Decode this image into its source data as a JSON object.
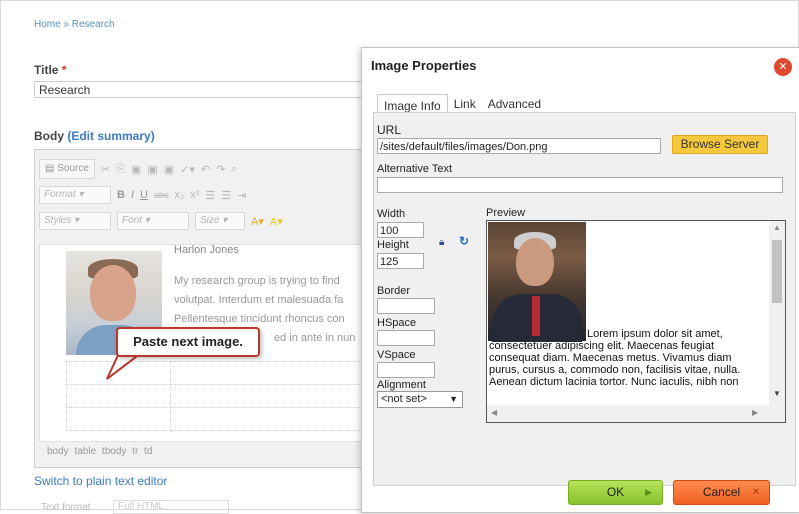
{
  "breadcrumb": {
    "text": "Home » Research"
  },
  "title_field": {
    "label": "Title",
    "required_mark": "*",
    "value": "Research"
  },
  "body_field": {
    "label": "Body",
    "edit_summary": "(Edit summary)"
  },
  "editor": {
    "source_label": "Source",
    "format_label": "Format",
    "styles_label": "Styles",
    "font_label": "Font",
    "size_label": "Size",
    "content_name": "Harlon Jones",
    "content_lines": [
      "My research group is trying to find",
      "volutpat. Interdum et malesuada fa",
      "Pellentesque tincidunt rhoncus con",
      "ed in ante in nun"
    ],
    "status_path": "body table tbody tr td"
  },
  "switch_link": "Switch to plain text editor",
  "bottom_field": {
    "label": "Text format",
    "value": "Full HTML"
  },
  "callout": {
    "text": "Paste next image."
  },
  "dialog": {
    "title": "Image Properties",
    "tabs": [
      "Image Info",
      "Link",
      "Advanced"
    ],
    "url_label": "URL",
    "url_value": "/sites/default/files/images/Don.png",
    "browse_label": "Browse Server",
    "alt_label": "Alternative Text",
    "alt_value": "",
    "width_label": "Width",
    "width_value": "100",
    "height_label": "Height",
    "height_value": "125",
    "border_label": "Border",
    "hspace_label": "HSpace",
    "vspace_label": "VSpace",
    "alignment_label": "Alignment",
    "alignment_value": "<not set>",
    "preview_label": "Preview",
    "preview_text": "Lorem ipsum dolor sit amet, consectetuer adipiscing elit. Maecenas feugiat consequat diam. Maecenas metus. Vivamus diam purus, cursus a, commodo non, facilisis vitae, nulla. Aenean dictum lacinia tortor. Nunc iaculis, nibh non",
    "ok_label": "OK",
    "cancel_label": "Cancel"
  },
  "colors": {
    "link": "#3b7bbf",
    "ok_green": "#86c22c",
    "cancel_orange": "#ef5f21",
    "browse_yellow": "#f6c83d",
    "close_red": "#e0472f"
  }
}
